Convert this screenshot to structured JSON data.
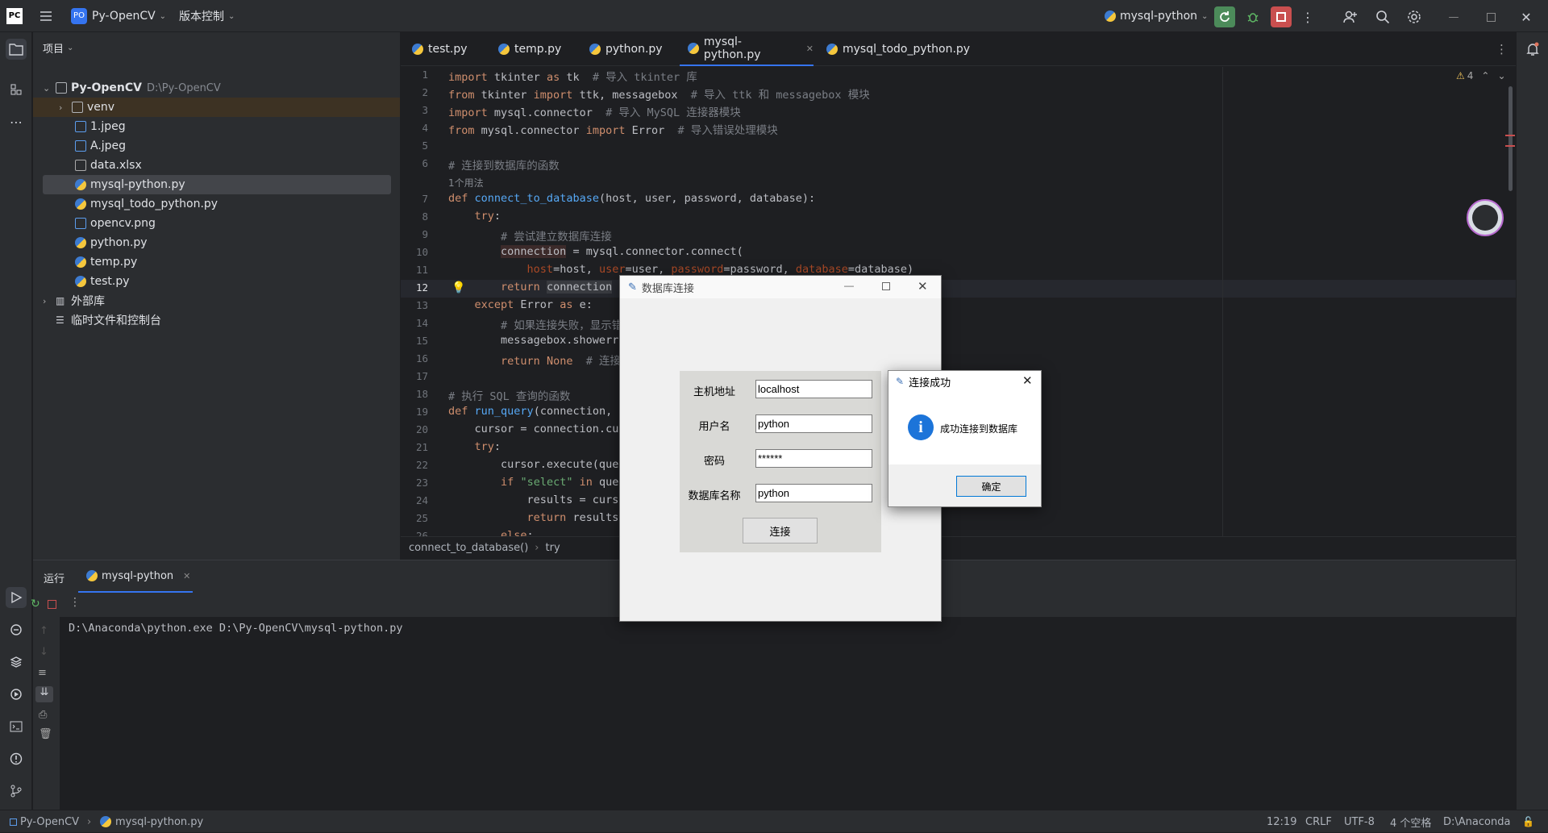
{
  "titlebar": {
    "logo": "PC",
    "project_badge": "PO",
    "project_name": "Py-OpenCV",
    "vcs_label": "版本控制",
    "run_config": "mysql-python"
  },
  "project_panel": {
    "title": "项目",
    "root_name": "Py-OpenCV",
    "root_path": "D:\\Py-OpenCV",
    "items": [
      {
        "label": "venv",
        "type": "folder"
      },
      {
        "label": "1.jpeg",
        "type": "image"
      },
      {
        "label": "A.jpeg",
        "type": "image"
      },
      {
        "label": "data.xlsx",
        "type": "excel"
      },
      {
        "label": "mysql-python.py",
        "type": "python"
      },
      {
        "label": "mysql_todo_python.py",
        "type": "python"
      },
      {
        "label": "opencv.png",
        "type": "image"
      },
      {
        "label": "python.py",
        "type": "python"
      },
      {
        "label": "temp.py",
        "type": "python"
      },
      {
        "label": "test.py",
        "type": "python"
      }
    ],
    "external_libs": "外部库",
    "scratches": "临时文件和控制台"
  },
  "tabs": [
    {
      "label": "test.py"
    },
    {
      "label": "temp.py"
    },
    {
      "label": "python.py"
    },
    {
      "label": "mysql-python.py"
    },
    {
      "label": "mysql_todo_python.py"
    }
  ],
  "editor": {
    "warnings": "4",
    "usage_hint": "1个用法",
    "breadcrumb": [
      "connect_to_database()",
      "try"
    ],
    "lines": [
      "1",
      "2",
      "3",
      "4",
      "5",
      "6",
      "",
      "7",
      "8",
      "9",
      "10",
      "11",
      "12",
      "13",
      "14",
      "15",
      "16",
      "17",
      "18",
      "19",
      "20",
      "21",
      "22",
      "23",
      "24",
      "25",
      "26"
    ]
  },
  "run_panel": {
    "title": "运行",
    "tab": "mysql-python",
    "console": "D:\\Anaconda\\python.exe D:\\Py-OpenCV\\mysql-python.py"
  },
  "statusbar": {
    "project": "Py-OpenCV",
    "file": "mysql-python.py",
    "position": "12:19",
    "line_sep": "CRLF",
    "encoding": "UTF-8",
    "indent": "4 个空格",
    "interpreter": "D:\\Anaconda"
  },
  "tk_window": {
    "title": "数据库连接",
    "host_label": "主机地址",
    "host_value": "localhost",
    "user_label": "用户名",
    "user_value": "python",
    "password_label": "密码",
    "password_value": "******",
    "db_label": "数据库名称",
    "db_value": "python",
    "connect_button": "连接"
  },
  "message_box": {
    "title": "连接成功",
    "message": "成功连接到数据库",
    "ok_button": "确定"
  }
}
